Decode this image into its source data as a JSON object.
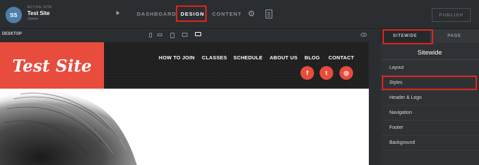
{
  "site": {
    "avatar": "SS",
    "label": "ACTIVE SITE",
    "name": "Test Site",
    "role": "Owner"
  },
  "topnav": {
    "dashboard": "DASHBOARD",
    "design": "DESIGN",
    "content": "CONTENT",
    "publish": "PUBLISH"
  },
  "subbar": {
    "label": "DESKTOP"
  },
  "preview": {
    "logo": "Test Site",
    "nav": [
      "HOW TO JOIN",
      "CLASSES",
      "SCHEDULE",
      "ABOUT US",
      "BLOG",
      "CONTACT"
    ],
    "social": [
      "f",
      "t",
      "◎"
    ]
  },
  "sidebar": {
    "tabs": [
      "SITEWIDE",
      "PAGE"
    ],
    "title": "Sitewide",
    "items": [
      "Layout",
      "Styles",
      "Header & Logo",
      "Navigation",
      "Footer",
      "Background"
    ]
  },
  "colors": {
    "accent": "#e84c3d",
    "highlight": "#e1251b"
  }
}
